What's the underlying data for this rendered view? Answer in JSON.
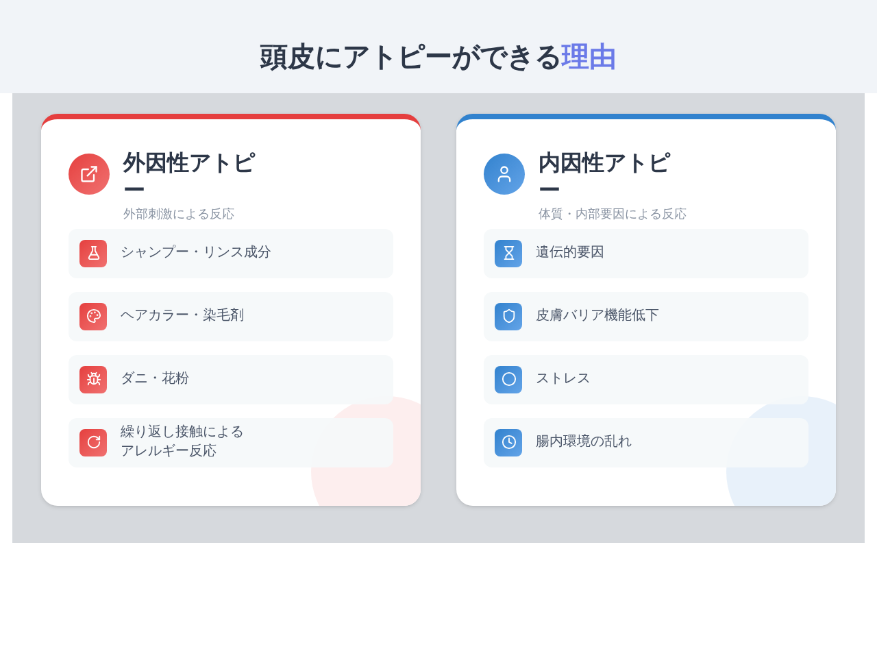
{
  "heading": {
    "text": "頭皮にアトピーができる",
    "highlight": "理由"
  },
  "cards": [
    {
      "kind": "external",
      "title": "外因性アトピー",
      "subtitle": "外部刺激による反応",
      "items": [
        {
          "lines": [
            "シャンプー・リンス成分"
          ]
        },
        {
          "lines": [
            "ヘアカラー・染毛剤"
          ]
        },
        {
          "lines": [
            "ダニ・花粉"
          ]
        },
        {
          "lines": [
            "繰り返し接触による",
            "アレルギー反応"
          ]
        }
      ]
    },
    {
      "kind": "internal",
      "title": "内因性アトピー",
      "subtitle": "体質・内部要因による反応",
      "items": [
        {
          "lines": [
            "遺伝的要因"
          ]
        },
        {
          "lines": [
            "皮膚バリア機能低下"
          ]
        },
        {
          "lines": [
            "ストレス"
          ]
        },
        {
          "lines": [
            "腸内環境の乱れ"
          ]
        }
      ]
    }
  ]
}
